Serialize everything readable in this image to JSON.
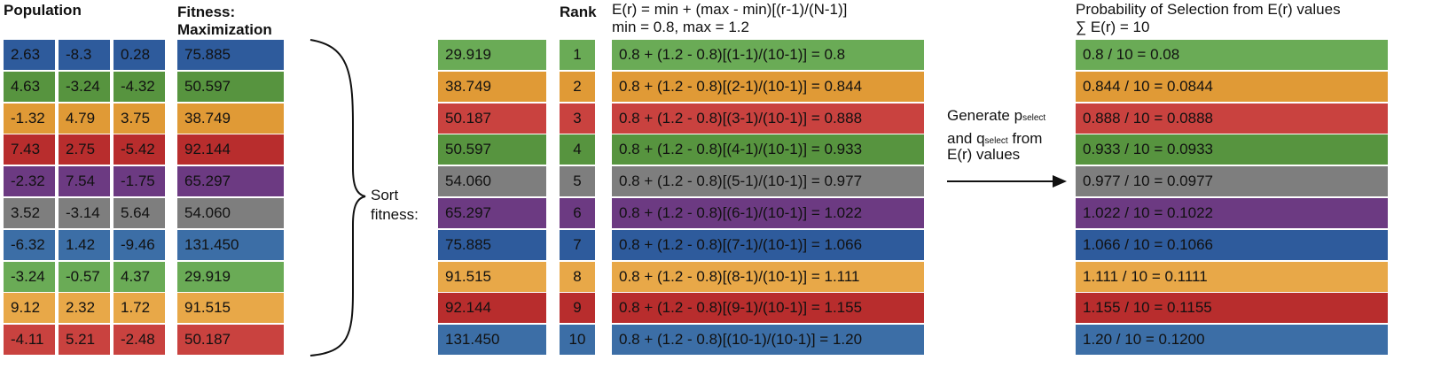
{
  "headers": {
    "population": "Population",
    "fitness_line1": "Fitness:",
    "fitness_line2": "Maximization",
    "rank": "Rank",
    "er_formula": "E(r) = min + (max - min)[(r-1)/(N-1)]",
    "er_params": "min = 0.8, max = 1.2",
    "prob_title": "Probability of Selection from E(r) values",
    "prob_sum": "∑  E(r) = 10"
  },
  "sort_label": {
    "line1": "Sort",
    "line2": "fitness:"
  },
  "generate": {
    "line1_prefix": "Generate p",
    "line1_sub": "select",
    "line2_prefix": "and q",
    "line2_sub": "select",
    "line2_suffix": " from",
    "line3": "E(r) values"
  },
  "colors": {
    "blue": "#2e5b9c",
    "green": "#57943f",
    "orange": "#e09a36",
    "red": "#b82d2d",
    "purple": "#6c3a82",
    "gray": "#7e7e7e",
    "blue_light": "#3c6ea6",
    "green_light": "#6aab56",
    "orange_light": "#e8a848",
    "red_light": "#c9423f"
  },
  "population": [
    {
      "values": [
        "2.63",
        "-8.3",
        "0.28"
      ],
      "fitness": "75.885",
      "color": "#2e5b9c"
    },
    {
      "values": [
        "4.63",
        "-3.24",
        "-4.32"
      ],
      "fitness": "50.597",
      "color": "#57943f"
    },
    {
      "values": [
        "-1.32",
        "4.79",
        "3.75"
      ],
      "fitness": "38.749",
      "color": "#e09a36"
    },
    {
      "values": [
        "7.43",
        "2.75",
        "-5.42"
      ],
      "fitness": "92.144",
      "color": "#b82d2d"
    },
    {
      "values": [
        "-2.32",
        "7.54",
        "-1.75"
      ],
      "fitness": "65.297",
      "color": "#6c3a82"
    },
    {
      "values": [
        "3.52",
        "-3.14",
        "5.64"
      ],
      "fitness": "54.060",
      "color": "#7e7e7e"
    },
    {
      "values": [
        "-6.32",
        "1.42",
        "-9.46"
      ],
      "fitness": "131.450",
      "color": "#3c6ea6"
    },
    {
      "values": [
        "-3.24",
        "-0.57",
        "4.37"
      ],
      "fitness": "29.919",
      "color": "#6aab56"
    },
    {
      "values": [
        "9.12",
        "2.32",
        "1.72"
      ],
      "fitness": "91.515",
      "color": "#e8a848"
    },
    {
      "values": [
        "-4.11",
        "5.21",
        "-2.48"
      ],
      "fitness": "50.187",
      "color": "#c9423f"
    }
  ],
  "sorted": [
    {
      "fitness": "29.919",
      "rank": "1",
      "er": "0.8 + (1.2 - 0.8)[(1-1)/(10-1)] = 0.8",
      "prob": "0.8 / 10 = 0.08",
      "color": "#6aab56"
    },
    {
      "fitness": "38.749",
      "rank": "2",
      "er": "0.8 + (1.2 - 0.8)[(2-1)/(10-1)] = 0.844",
      "prob": "0.844 / 10 = 0.0844",
      "color": "#e09a36"
    },
    {
      "fitness": "50.187",
      "rank": "3",
      "er": "0.8 + (1.2 - 0.8)[(3-1)/(10-1)] = 0.888",
      "prob": "0.888 / 10 = 0.0888",
      "color": "#c9423f"
    },
    {
      "fitness": "50.597",
      "rank": "4",
      "er": "0.8 + (1.2 - 0.8)[(4-1)/(10-1)] = 0.933",
      "prob": "0.933 / 10 = 0.0933",
      "color": "#57943f"
    },
    {
      "fitness": "54.060",
      "rank": "5",
      "er": "0.8 + (1.2 - 0.8)[(5-1)/(10-1)] = 0.977",
      "prob": "0.977 / 10 = 0.0977",
      "color": "#7e7e7e"
    },
    {
      "fitness": "65.297",
      "rank": "6",
      "er": "0.8 + (1.2 - 0.8)[(6-1)/(10-1)] = 1.022",
      "prob": "1.022 / 10 = 0.1022",
      "color": "#6c3a82"
    },
    {
      "fitness": "75.885",
      "rank": "7",
      "er": "0.8 + (1.2 - 0.8)[(7-1)/(10-1)] = 1.066",
      "prob": "1.066 / 10 = 0.1066",
      "color": "#2e5b9c"
    },
    {
      "fitness": "91.515",
      "rank": "8",
      "er": "0.8 + (1.2 - 0.8)[(8-1)/(10-1)] = 1.111",
      "prob": "1.111 / 10 = 0.1111",
      "color": "#e8a848"
    },
    {
      "fitness": "92.144",
      "rank": "9",
      "er": "0.8 + (1.2 - 0.8)[(9-1)/(10-1)] = 1.155",
      "prob": "1.155 / 10 = 0.1155",
      "color": "#b82d2d"
    },
    {
      "fitness": "131.450",
      "rank": "10",
      "er": "0.8 + (1.2 - 0.8)[(10-1)/(10-1)] = 1.20",
      "prob": "1.20 / 10 = 0.1200",
      "color": "#3c6ea6"
    }
  ]
}
